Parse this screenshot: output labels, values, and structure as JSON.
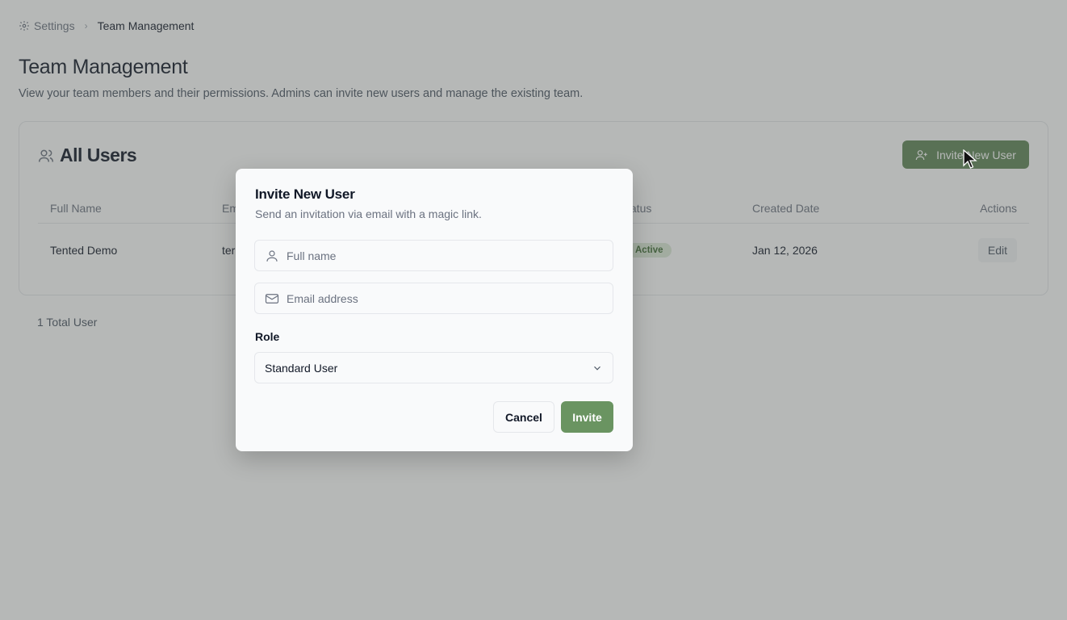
{
  "breadcrumb": {
    "root": "Settings",
    "current": "Team Management"
  },
  "page": {
    "title": "Team Management",
    "description": "View your team members and their permissions. Admins can invite new users and manage the existing team."
  },
  "users_card": {
    "title": "All Users",
    "invite_button": "Invite New User",
    "columns": {
      "full_name": "Full Name",
      "email": "Em",
      "status": "tatus",
      "created_date": "Created Date",
      "actions": "Actions"
    },
    "rows": [
      {
        "full_name": "Tented Demo",
        "email": "ter",
        "status": "Active",
        "created_date": "Jan 12, 2026",
        "action": "Edit"
      }
    ],
    "total": "1 Total User"
  },
  "modal": {
    "title": "Invite New User",
    "subtitle": "Send an invitation via email with a magic link.",
    "full_name_placeholder": "Full name",
    "full_name_value": "",
    "email_placeholder": "Email address",
    "email_value": "",
    "role_label": "Role",
    "role_selected": "Standard User",
    "cancel_label": "Cancel",
    "submit_label": "Invite"
  },
  "colors": {
    "accent": "#5f8556",
    "submit": "#6a9461",
    "status_bg": "#dcead8",
    "status_text": "#3f6b34"
  },
  "icons": {
    "breadcrumb": "gear-icon",
    "card_title": "users-icon",
    "invite": "user-plus-icon",
    "full_name": "user-icon",
    "email": "mail-icon",
    "select": "chevron-down-icon",
    "breadcrumb_separator": "chevron-right-icon"
  }
}
